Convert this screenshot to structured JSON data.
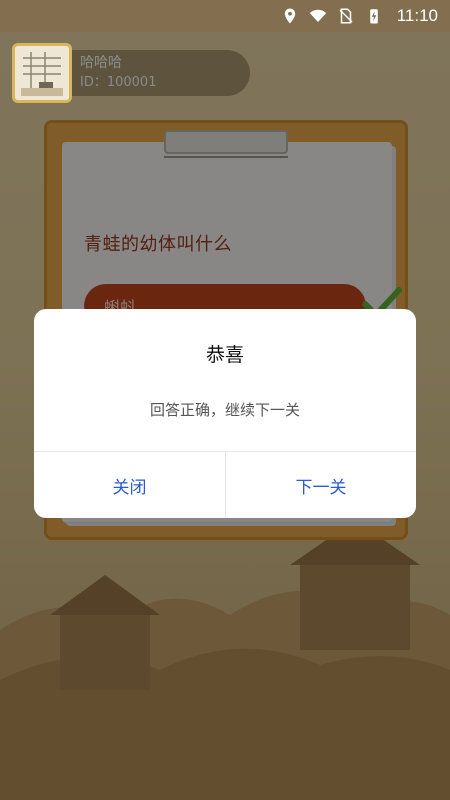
{
  "status_bar": {
    "time": "11:10",
    "icons": [
      "location-icon",
      "wifi-icon",
      "no-sim-icon",
      "battery-charging-icon"
    ]
  },
  "user": {
    "name": "哈哈哈",
    "id_text": "ID：100001"
  },
  "quiz": {
    "question": "青蛙的幼体叫什么",
    "selected_answer": "蝌蚪",
    "answer_state": "correct"
  },
  "dialog": {
    "title": "恭喜",
    "message": "回答正确，继续下一关",
    "close_label": "关闭",
    "next_label": "下一关"
  },
  "colors": {
    "accent": "#2a5bd7",
    "answer_bg": "#c4461e",
    "question_text": "#9a3a1f",
    "board": "#eaa94a"
  }
}
